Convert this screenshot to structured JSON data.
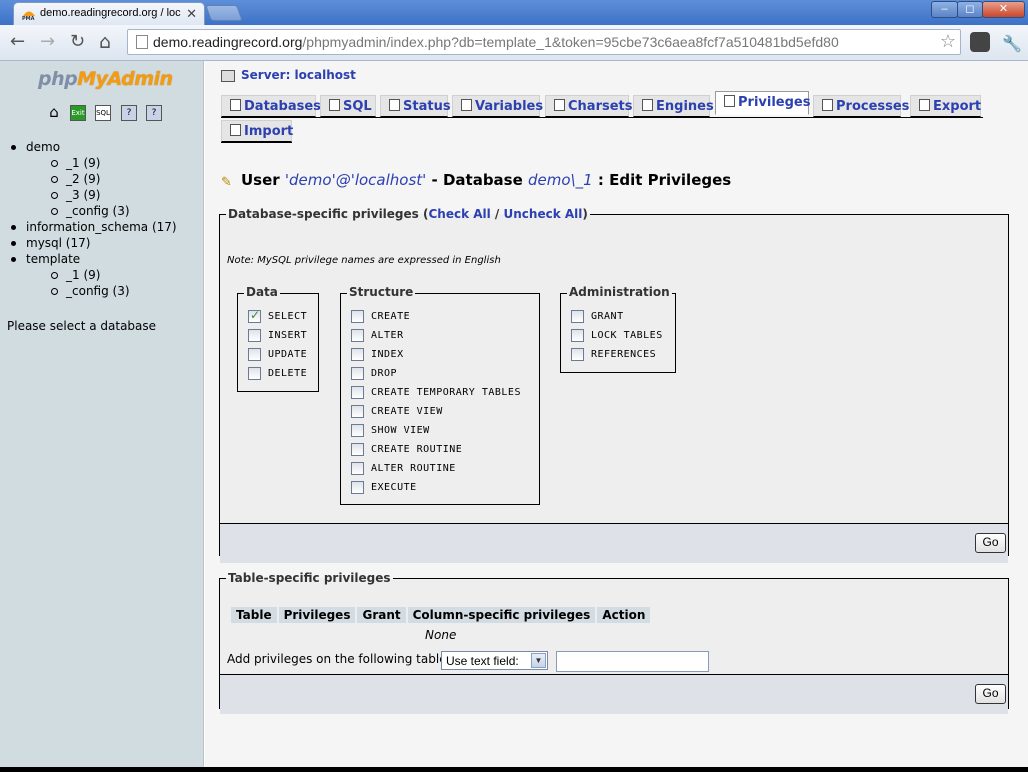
{
  "browser": {
    "tab_title": "demo.readingrecord.org / loc",
    "favicon_text": "PMA",
    "url_host": "demo.readingrecord.org",
    "url_rest": "/phpmyadmin/index.php?db=template_1&token=95cbe73c6aea8fcf7a510481bd5efd80",
    "window_buttons": {
      "minimize": "–",
      "maximize": "◻",
      "close": "✕"
    },
    "nav": {
      "back": "←",
      "forward": "→",
      "reload": "↻",
      "home": "⌂"
    },
    "icons": [
      "star-icon",
      "extension-icon",
      "wrench-icon"
    ]
  },
  "sidebar": {
    "logo_php": "php",
    "logo_myadmin": "MyAdmin",
    "icons": [
      "home-icon",
      "exit-icon",
      "sql-query-icon",
      "docs-icon",
      "help-icon"
    ],
    "icon_text": [
      "⌂",
      "Exit",
      "SQL",
      "?",
      "?"
    ],
    "databases": [
      {
        "name": "demo",
        "tables": [
          "_1 (9)",
          "_2 (9)",
          "_3 (9)",
          "_config (3)"
        ]
      },
      {
        "name": "information_schema (17)",
        "tables": []
      },
      {
        "name": "mysql (17)",
        "tables": []
      },
      {
        "name": "template",
        "tables": [
          "_1 (9)",
          "_config (3)"
        ]
      }
    ],
    "hint": "Please select a database"
  },
  "main": {
    "server_label": "Server: localhost",
    "tabs": [
      {
        "label": "Databases",
        "active": false
      },
      {
        "label": "SQL",
        "active": false
      },
      {
        "label": "Status",
        "active": false
      },
      {
        "label": "Variables",
        "active": false
      },
      {
        "label": "Charsets",
        "active": false
      },
      {
        "label": "Engines",
        "active": false
      },
      {
        "label": "Privileges",
        "active": true
      },
      {
        "label": "Processes",
        "active": false
      },
      {
        "label": "Export",
        "active": false
      },
      {
        "label": "Import",
        "active": false
      }
    ],
    "heading": {
      "user_prefix": "User ",
      "user": "'demo'@'localhost'",
      "db_prefix": " - Database ",
      "db": "demo\\_1",
      "suffix": " : Edit Privileges"
    },
    "db_privileges": {
      "legend": "Database-specific privileges (",
      "check_all": "Check All",
      "sep": " / ",
      "uncheck_all": "Uncheck All",
      "legend_end": ")",
      "note": "Note: MySQL privilege names are expressed in English",
      "groups": [
        {
          "title": "Data",
          "items": [
            {
              "label": "SELECT",
              "checked": true
            },
            {
              "label": "INSERT",
              "checked": false
            },
            {
              "label": "UPDATE",
              "checked": false
            },
            {
              "label": "DELETE",
              "checked": false
            }
          ]
        },
        {
          "title": "Structure",
          "items": [
            {
              "label": "CREATE",
              "checked": false
            },
            {
              "label": "ALTER",
              "checked": false
            },
            {
              "label": "INDEX",
              "checked": false
            },
            {
              "label": "DROP",
              "checked": false
            },
            {
              "label": "CREATE TEMPORARY TABLES",
              "checked": false
            },
            {
              "label": "CREATE VIEW",
              "checked": false
            },
            {
              "label": "SHOW VIEW",
              "checked": false
            },
            {
              "label": "CREATE ROUTINE",
              "checked": false
            },
            {
              "label": "ALTER ROUTINE",
              "checked": false
            },
            {
              "label": "EXECUTE",
              "checked": false
            }
          ]
        },
        {
          "title": "Administration",
          "items": [
            {
              "label": "GRANT",
              "checked": false
            },
            {
              "label": "LOCK TABLES",
              "checked": false
            },
            {
              "label": "REFERENCES",
              "checked": false
            }
          ]
        }
      ],
      "go": "Go"
    },
    "table_privileges": {
      "legend": "Table-specific privileges",
      "columns": [
        "Table",
        "Privileges",
        "Grant",
        "Column-specific privileges",
        "Action"
      ],
      "empty": "None",
      "add_label": "Add privileges on the following table:",
      "select_value": "Use text field:",
      "text_value": "",
      "go": "Go"
    }
  }
}
